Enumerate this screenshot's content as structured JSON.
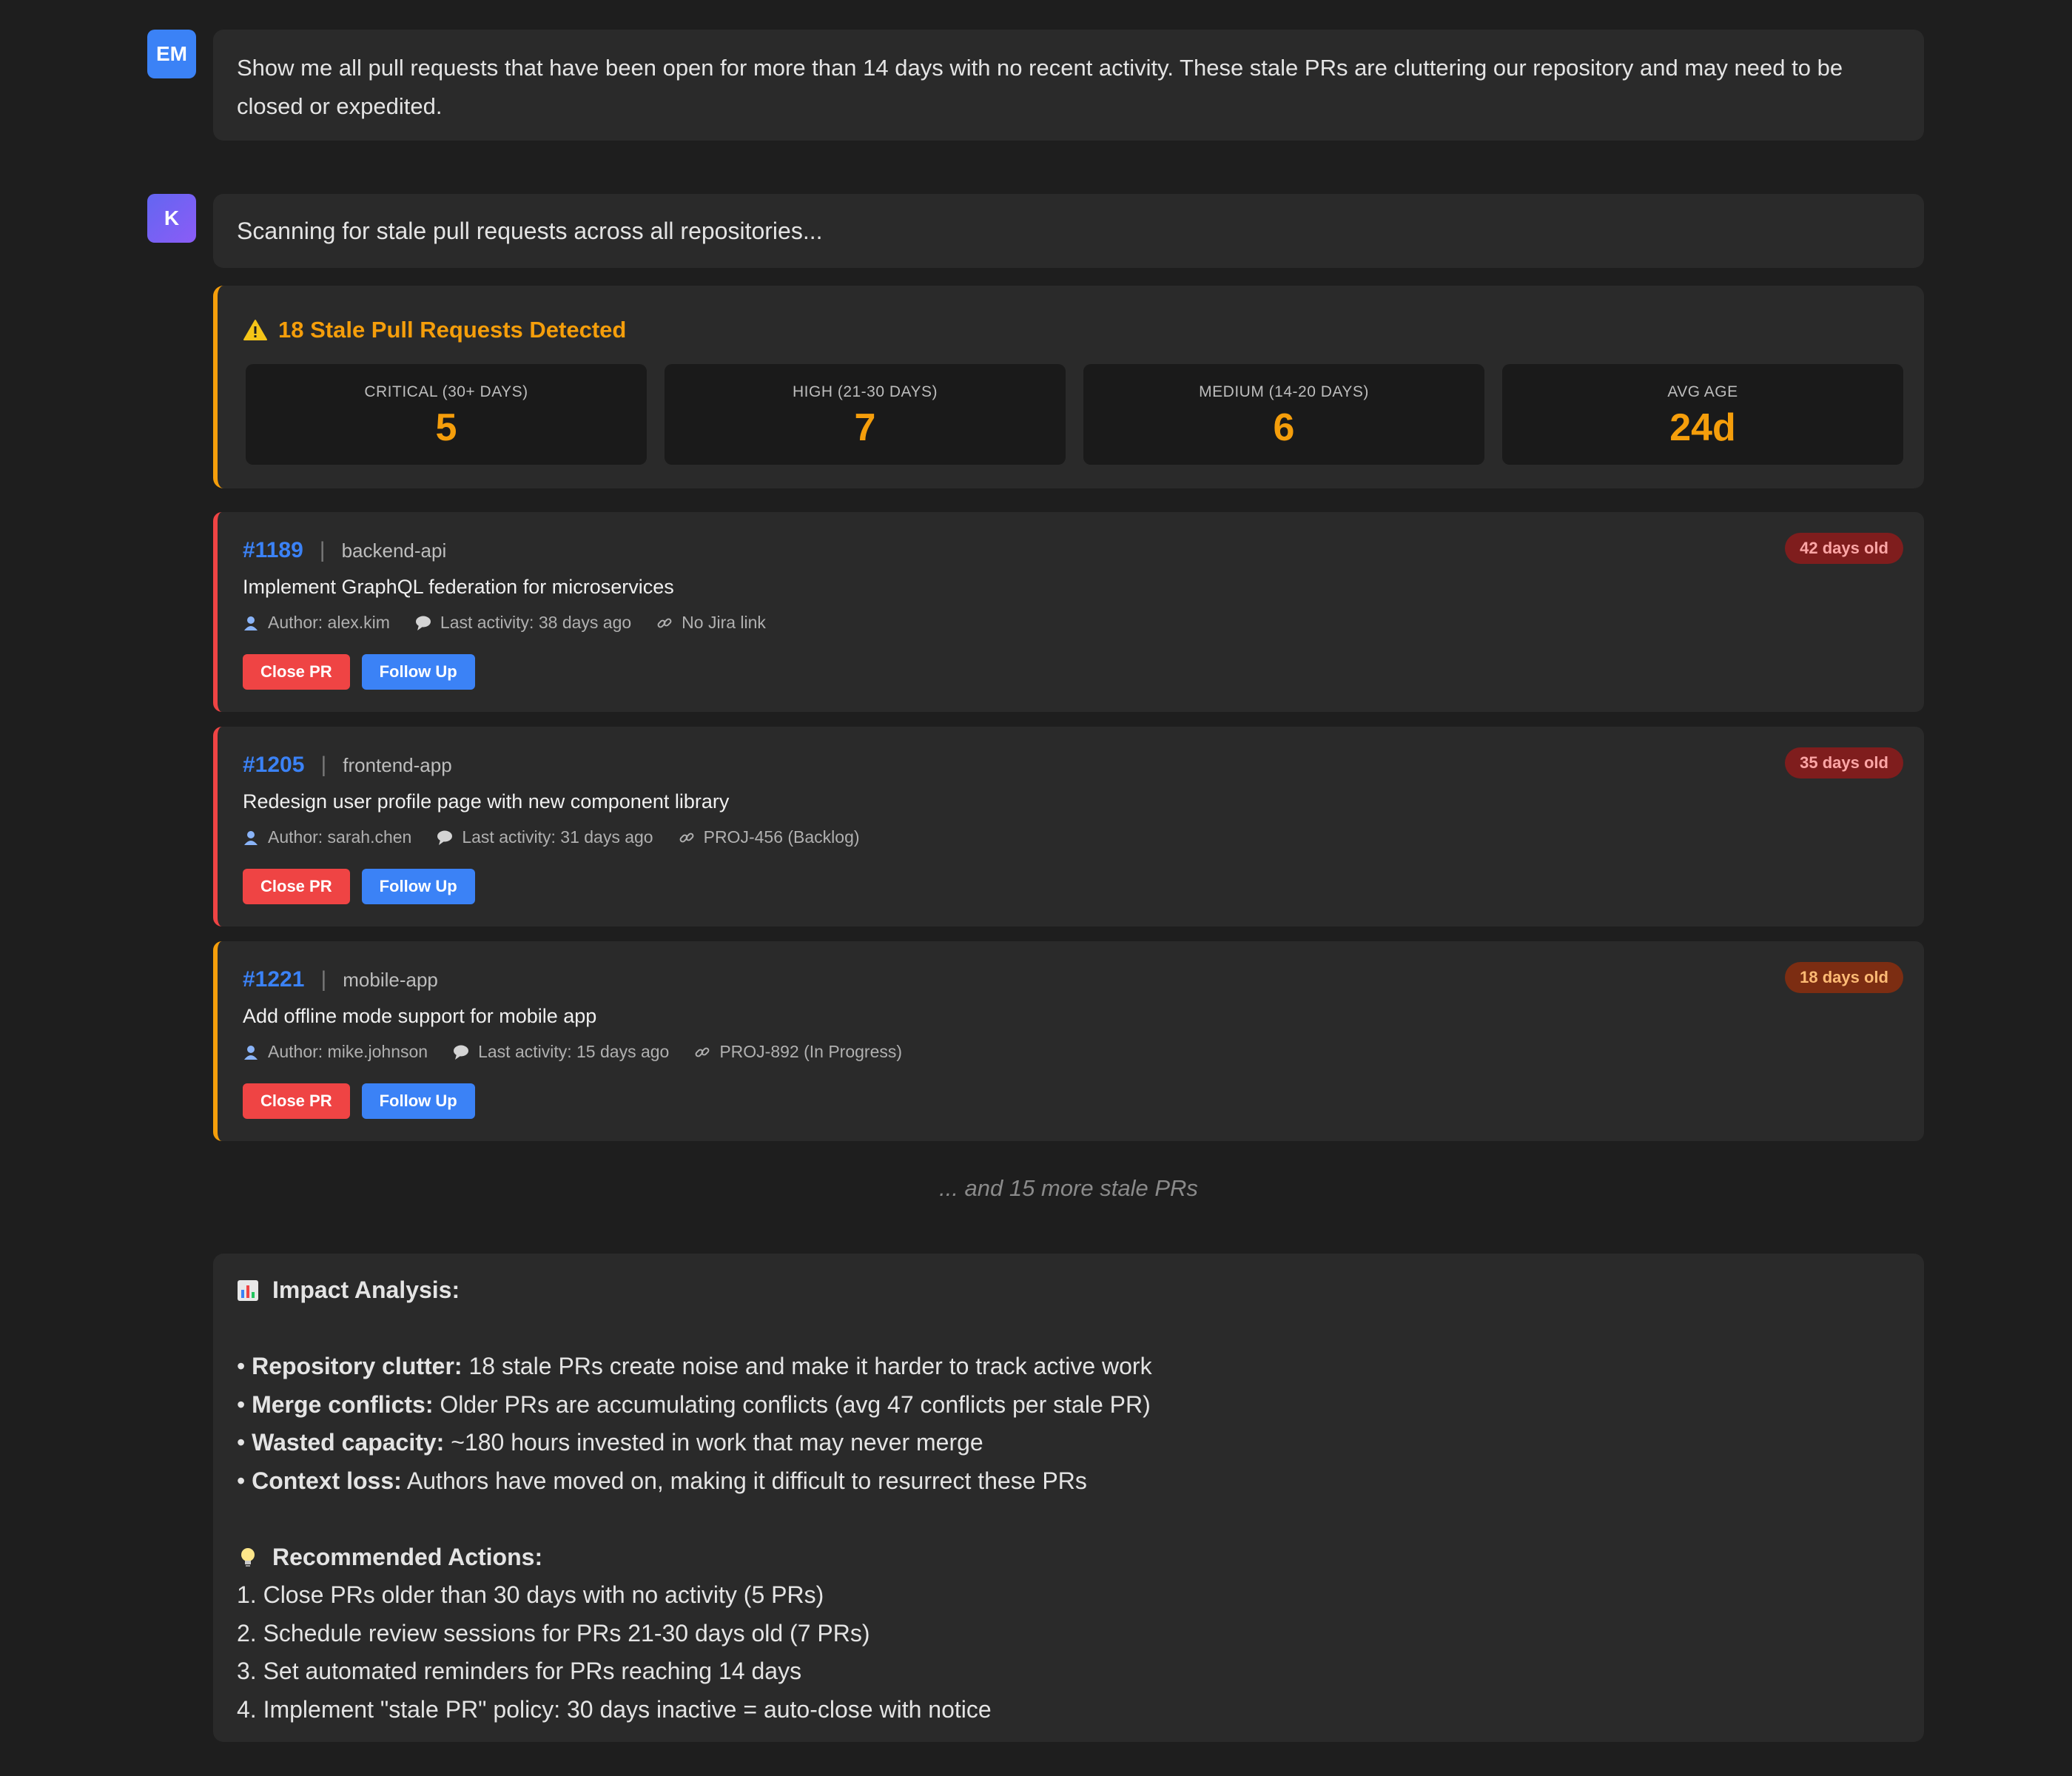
{
  "user_message": {
    "avatar": "EM",
    "text": "Show me all pull requests that have been open for more than 14 days with no recent activity. These stale PRs are cluttering our repository and may need to be closed or expedited."
  },
  "assistant": {
    "avatar": "K",
    "scan_text": "Scanning for stale pull requests across all repositories..."
  },
  "summary": {
    "icon": "warning-icon",
    "title": "18 Stale Pull Requests Detected",
    "stats": [
      {
        "label": "CRITICAL (30+ DAYS)",
        "value": "5"
      },
      {
        "label": "HIGH (21-30 DAYS)",
        "value": "7"
      },
      {
        "label": "MEDIUM (14-20 DAYS)",
        "value": "6"
      },
      {
        "label": "AVG AGE",
        "value": "24d"
      }
    ]
  },
  "prs": [
    {
      "number": "#1189",
      "separator": "|",
      "repo": "backend-api",
      "title": "Implement GraphQL federation for microservices",
      "author": "Author: alex.kim",
      "activity": "Last activity: 38 days ago",
      "jira": "No Jira link",
      "age": "42 days old",
      "close_label": "Close PR",
      "follow_label": "Follow Up"
    },
    {
      "number": "#1205",
      "separator": "|",
      "repo": "frontend-app",
      "title": "Redesign user profile page with new component library",
      "author": "Author: sarah.chen",
      "activity": "Last activity: 31 days ago",
      "jira": "PROJ-456 (Backlog)",
      "age": "35 days old",
      "close_label": "Close PR",
      "follow_label": "Follow Up"
    },
    {
      "number": "#1221",
      "separator": "|",
      "repo": "mobile-app",
      "title": "Add offline mode support for mobile app",
      "author": "Author: mike.johnson",
      "activity": "Last activity: 15 days ago",
      "jira": "PROJ-892 (In Progress)",
      "age": "18 days old",
      "close_label": "Close PR",
      "follow_label": "Follow Up"
    }
  ],
  "more_text": "... and 15 more stale PRs",
  "impact": {
    "title": "Impact Analysis:",
    "icon": "bar-chart-icon",
    "bullets": [
      {
        "label": "Repository clutter:",
        "text": " 18 stale PRs create noise and make it harder to track active work"
      },
      {
        "label": "Merge conflicts:",
        "text": " Older PRs are accumulating conflicts (avg 47 conflicts per stale PR)"
      },
      {
        "label": "Wasted capacity:",
        "text": " ~180 hours invested in work that may never merge"
      },
      {
        "label": "Context loss:",
        "text": " Authors have moved on, making it difficult to resurrect these PRs"
      }
    ],
    "bullet_char": "•",
    "actions_title": "Recommended Actions:",
    "actions_icon": "lightbulb-icon",
    "actions": [
      "1. Close PRs older than 30 days with no activity (5 PRs)",
      "2. Schedule review sessions for PRs 21-30 days old (7 PRs)",
      "3. Set automated reminders for PRs reaching 14 days",
      "4. Implement \"stale PR\" policy: 30 days inactive = auto-close with notice"
    ]
  },
  "colors": {
    "background": "#1e1e1e",
    "card": "#2a2a2a",
    "accent_blue": "#3b82f6",
    "warning": "#f59e0b",
    "danger": "#ef4444"
  }
}
